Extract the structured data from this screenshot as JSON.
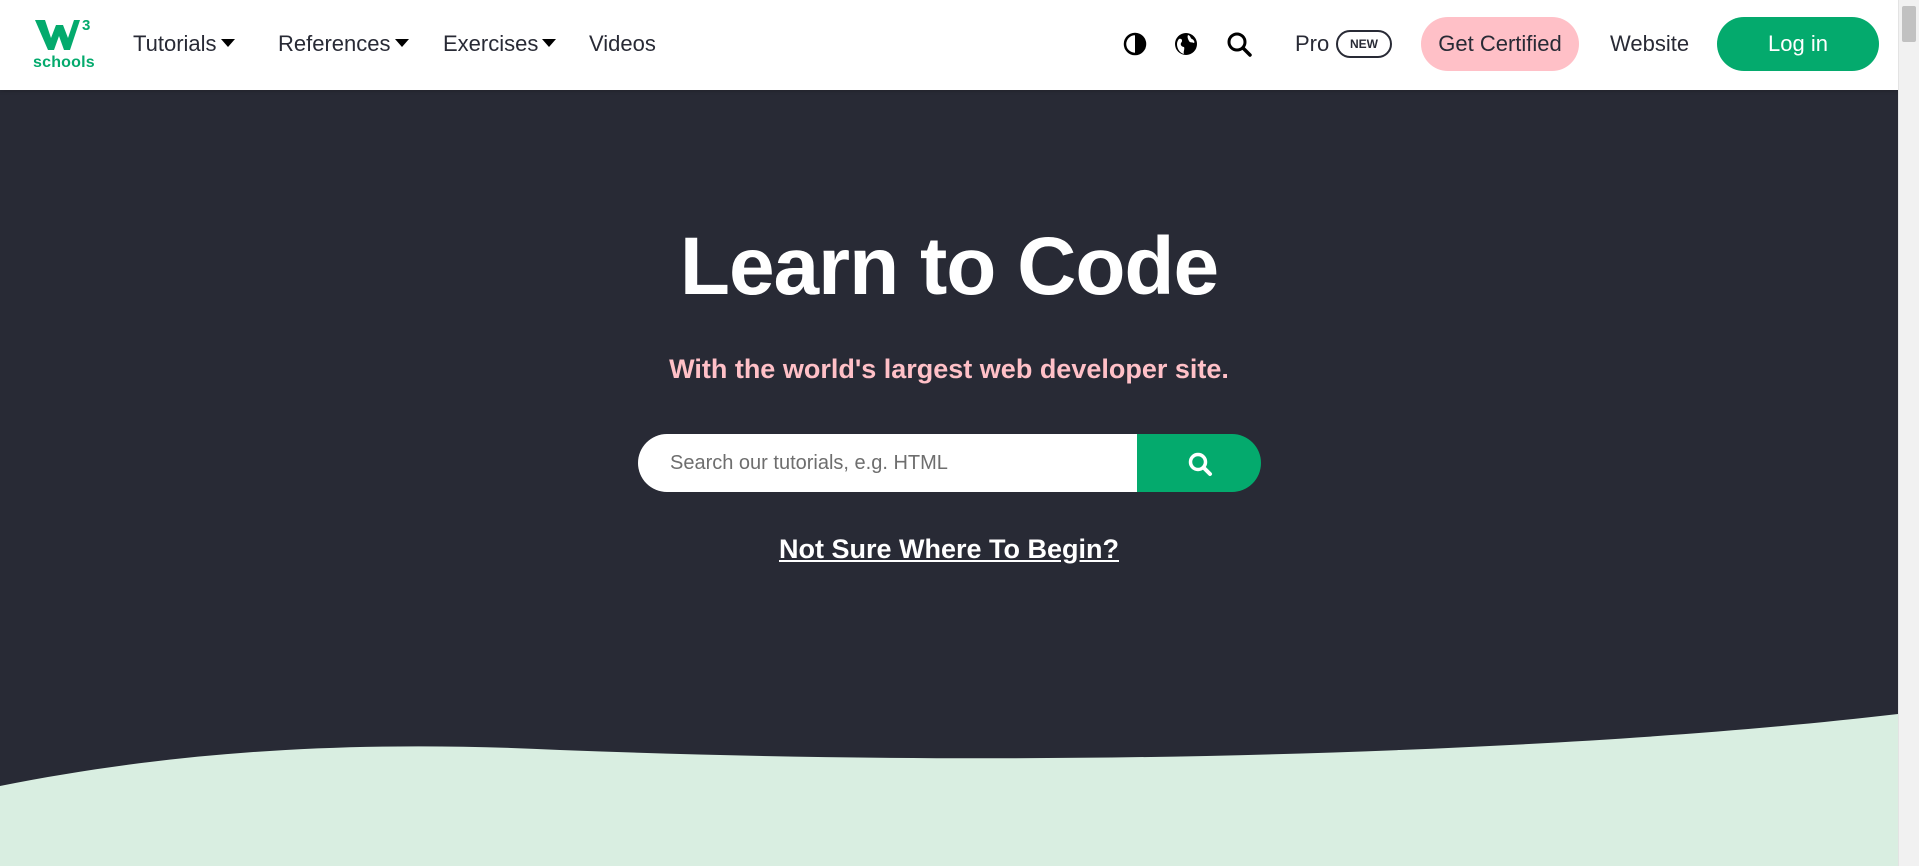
{
  "brand": {
    "logo_text": "schools",
    "logo_superscript": "3",
    "accent_color": "#04aa6d",
    "dark_color": "#282a35",
    "pink_color": "#ffc0c7",
    "mint_color": "#d9eee1"
  },
  "nav": {
    "items": [
      {
        "label": "Tutorials",
        "has_dropdown": true
      },
      {
        "label": "References",
        "has_dropdown": true
      },
      {
        "label": "Exercises",
        "has_dropdown": true
      },
      {
        "label": "Videos",
        "has_dropdown": false
      }
    ],
    "icons": [
      "contrast-icon",
      "globe-icon",
      "search-icon"
    ],
    "pro_label": "Pro",
    "new_badge": "NEW",
    "certified_label": "Get Certified",
    "website_label": "Website",
    "login_label": "Log in"
  },
  "hero": {
    "title": "Learn to Code",
    "subtitle": "With the world's largest web developer site.",
    "search_placeholder": "Search our tutorials, e.g. HTML",
    "search_value": "",
    "begin_link": "Not Sure Where To Begin?"
  }
}
